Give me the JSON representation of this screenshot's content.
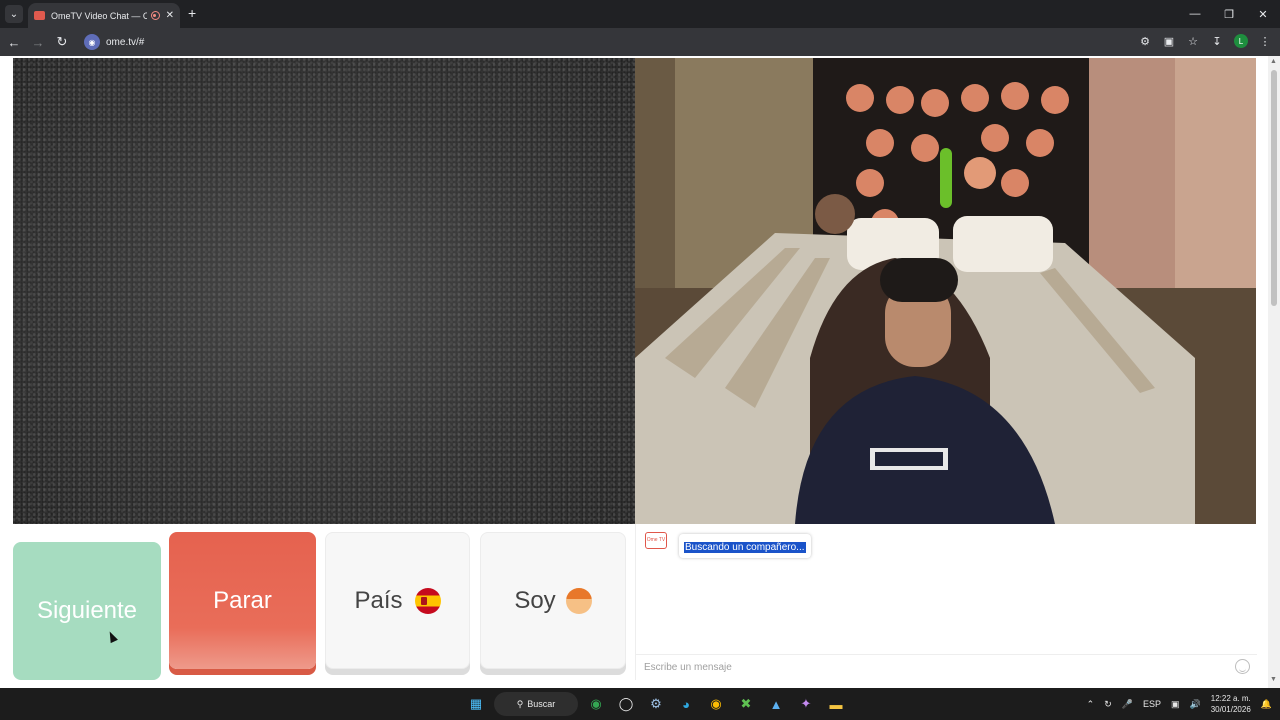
{
  "browser": {
    "tab_title": "OmeTV Video Chat — Ome",
    "url": "ome.tv/#",
    "profile_initial": "L"
  },
  "controls": {
    "next_label": "Siguiente",
    "stop_label": "Parar",
    "country_label": "País",
    "iam_label": "Soy"
  },
  "chat": {
    "logo_text": "Ome TV",
    "status_message": "Buscando un compañero...",
    "input_placeholder": "Escribe un mensaje"
  },
  "taskbar": {
    "search_label": "Buscar",
    "language": "ESP",
    "time": "12:22 a. m.",
    "date": "30/01/2026"
  },
  "colors": {
    "next_button": "#a6dcc0",
    "stop_button": "#e5624f",
    "selection": "#1a53c9"
  }
}
